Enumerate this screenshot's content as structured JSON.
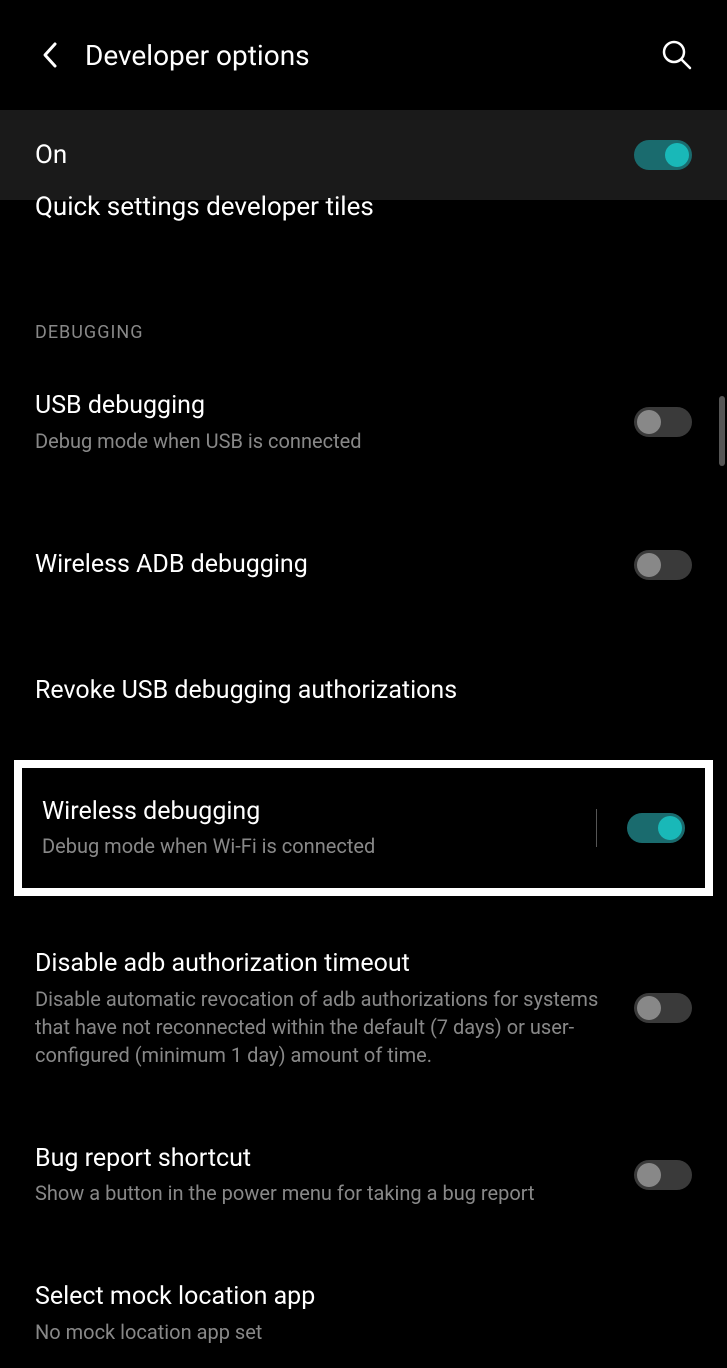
{
  "header": {
    "title": "Developer options"
  },
  "master": {
    "label": "On",
    "enabled": true
  },
  "partial_item": "Quick settings developer tiles",
  "section_label": "DEBUGGING",
  "settings": {
    "usb_debugging": {
      "title": "USB debugging",
      "subtitle": "Debug mode when USB is connected",
      "enabled": false
    },
    "wireless_adb": {
      "title": "Wireless ADB debugging",
      "enabled": false
    },
    "revoke_usb": {
      "title": "Revoke USB debugging authorizations"
    },
    "wireless_debugging": {
      "title": "Wireless debugging",
      "subtitle": "Debug mode when Wi-Fi is connected",
      "enabled": true
    },
    "disable_adb_timeout": {
      "title": "Disable adb authorization timeout",
      "subtitle": "Disable automatic revocation of adb authorizations for systems that have not reconnected within the default (7 days) or user-configured (minimum 1 day) amount of time.",
      "enabled": false
    },
    "bug_report": {
      "title": "Bug report shortcut",
      "subtitle": "Show a button in the power menu for taking a bug report",
      "enabled": false
    },
    "mock_location": {
      "title": "Select mock location app",
      "subtitle": "No mock location app set"
    }
  }
}
